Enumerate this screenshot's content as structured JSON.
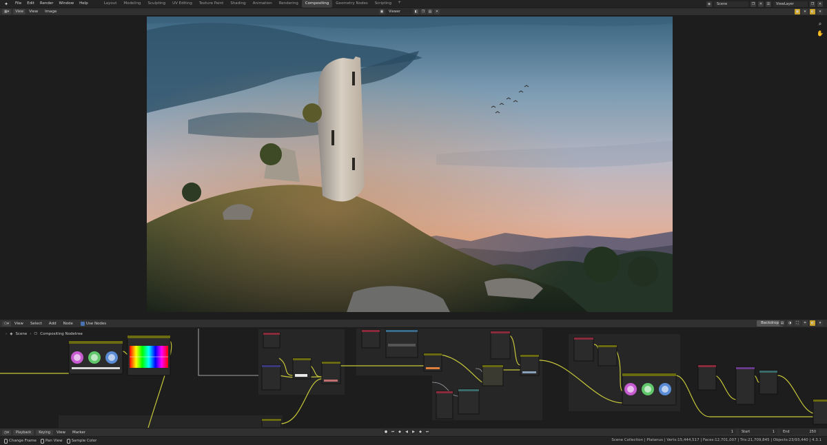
{
  "topbar": {
    "menus": [
      "File",
      "Edit",
      "Render",
      "Window",
      "Help"
    ],
    "workspaces": [
      "Layout",
      "Modeling",
      "Sculpting",
      "UV Editing",
      "Texture Paint",
      "Shading",
      "Animation",
      "Rendering",
      "Compositing",
      "Geometry Nodes",
      "Scripting"
    ],
    "active_workspace": "Compositing",
    "add_tab": "+",
    "scene": "Scene",
    "view_layer": "ViewLayer"
  },
  "image_editor": {
    "mode": "View",
    "menus": [
      "View",
      "Image"
    ],
    "viewer_name": "Viewer Node"
  },
  "node_editor": {
    "menus": [
      "View",
      "Select",
      "Add",
      "Node"
    ],
    "use_nodes_label": "Use Nodes",
    "use_nodes": true,
    "backdrop_label": "Backdrop",
    "breadcrumb": [
      "Scene",
      "Compositing Nodetree"
    ],
    "nodes": [
      {
        "id": "color-balance-1",
        "header": "#6a6a10",
        "type": "color-wheels"
      },
      {
        "id": "hue-correct",
        "header": "#6a6a10",
        "type": "hue-spectrum"
      },
      {
        "id": "viewer-a",
        "header": "#8a2a3a",
        "type": "small"
      },
      {
        "id": "math-a",
        "header": "#3a3a7a",
        "type": "small"
      },
      {
        "id": "mix-a",
        "header": "#6a6a10",
        "type": "small"
      },
      {
        "id": "mix-b",
        "header": "#6a6a10",
        "type": "small"
      },
      {
        "id": "image-b",
        "header": "#8a2a3a",
        "type": "small"
      },
      {
        "id": "blur-b",
        "header": "#3a6a8a",
        "type": "small"
      },
      {
        "id": "ramp-b",
        "header": "#6a6a10",
        "type": "small"
      },
      {
        "id": "image-c",
        "header": "#8a2a3a",
        "type": "small"
      },
      {
        "id": "mix-c",
        "header": "#6a6a10",
        "type": "small"
      },
      {
        "id": "mix-d",
        "header": "#6a6a10",
        "type": "small"
      },
      {
        "id": "image-e",
        "header": "#8a2a3a",
        "type": "small"
      },
      {
        "id": "color-balance-2",
        "header": "#6a6a10",
        "type": "color-wheels"
      },
      {
        "id": "image-f",
        "header": "#8a2a3a",
        "type": "small"
      },
      {
        "id": "group-f",
        "header": "#6a3a8a",
        "type": "small"
      },
      {
        "id": "filter-f",
        "header": "#3a6a6a",
        "type": "small"
      }
    ]
  },
  "timeline": {
    "playback": "Playback",
    "keying": "Keying",
    "menus": [
      "View",
      "Marker"
    ],
    "current_frame": "1",
    "start_label": "Start",
    "start": "1",
    "end_label": "End",
    "end": "250"
  },
  "statusbar": {
    "hints": [
      "Change Frame",
      "Pan View",
      "Sample Color"
    ],
    "stats": "Scene Collection | Platanus | Verts:15,444,517 | Faces:12,701,007 | Tris:21,709,845 | Objects:23/93,440 | 4.3.1"
  },
  "colors": {
    "accent": "#4772b3",
    "gold": "#c9a227",
    "link_yellow": "#c8c83a"
  }
}
